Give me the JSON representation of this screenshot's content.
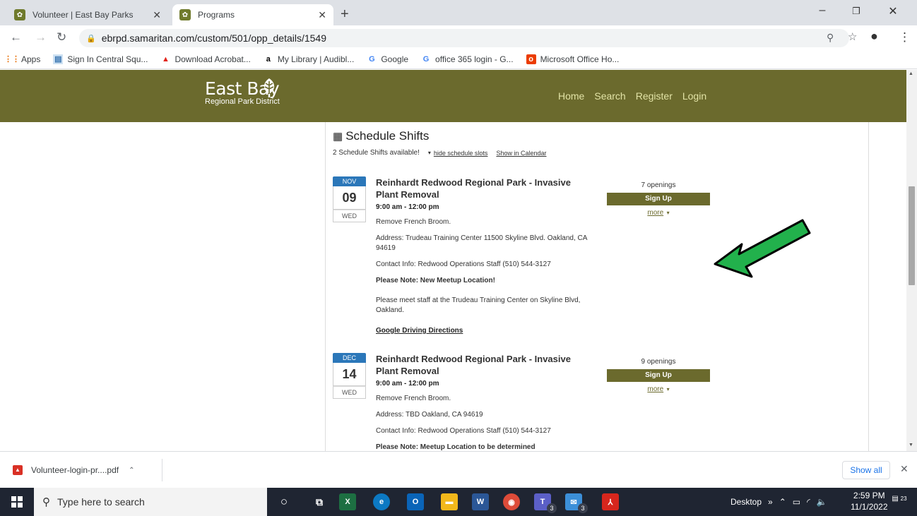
{
  "browser": {
    "tabs": [
      {
        "title": "Volunteer | East Bay Parks",
        "active": false
      },
      {
        "title": "Programs",
        "active": true
      }
    ],
    "new_tab_label": "+",
    "address": "ebrpd.samaritan.com/custom/501/opp_details/1549",
    "bookmarks": [
      {
        "label": "Apps",
        "icon": "apps-grid-icon"
      },
      {
        "label": "Sign In Central Squ...",
        "icon": "doc-icon"
      },
      {
        "label": "Download Acrobat...",
        "icon": "adobe-icon"
      },
      {
        "label": "My Library | Audibl...",
        "icon": "amazon-icon"
      },
      {
        "label": "Google",
        "icon": "google-icon"
      },
      {
        "label": "office 365 login - G...",
        "icon": "google-icon"
      },
      {
        "label": "Microsoft Office Ho...",
        "icon": "office-icon"
      }
    ]
  },
  "site": {
    "logo_main": "East Bay",
    "logo_sub": "Regional Park District",
    "nav": [
      "Home",
      "Search",
      "Register",
      "Login"
    ],
    "brand_color": "#6b6a2d"
  },
  "schedule": {
    "title": "Schedule Shifts",
    "available_text": "2 Schedule Shifts available!",
    "hide_link": "hide schedule slots",
    "calendar_link": "Show in Calendar",
    "shifts": [
      {
        "month": "NOV",
        "day": "09",
        "dow": "WED",
        "title": "Reinhardt Redwood Regional Park - Invasive Plant Removal",
        "time": "9:00 am - 12:00 pm",
        "desc": "Remove French Broom.",
        "address": "Address: Trudeau Training Center 11500 Skyline Blvd. Oakland, CA 94619",
        "contact": "Contact Info: Redwood Operations Staff (510) 544-3127",
        "note": "Please Note: New Meetup Location!",
        "note_detail": "Please meet staff at the Trudeau Training Center on Skyline Blvd, Oakland.",
        "directions": "Google Driving Directions",
        "openings": "7 openings",
        "signup": "Sign Up",
        "more": "more"
      },
      {
        "month": "DEC",
        "day": "14",
        "dow": "WED",
        "title": "Reinhardt Redwood Regional Park - Invasive Plant Removal",
        "time": "9:00 am - 12:00 pm",
        "desc": "Remove French Broom.",
        "address": "Address: TBD Oakland, CA 94619",
        "contact": "Contact Info: Redwood Operations Staff (510) 544-3127",
        "note": "Please Note: Meetup Location to be determined",
        "openings": "9 openings",
        "signup": "Sign Up",
        "more": "more"
      }
    ]
  },
  "downloads": {
    "file": "Volunteer-login-pr....pdf",
    "show_all": "Show all"
  },
  "taskbar": {
    "search_placeholder": "Type here to search",
    "desktop_label": "Desktop",
    "time": "2:59 PM",
    "date": "11/1/2022",
    "notification_count": "23",
    "badge_teams": "3",
    "badge_mail": "3"
  }
}
